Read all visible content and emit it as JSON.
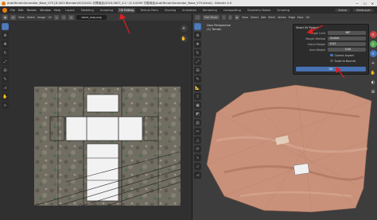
{
  "titlebar": {
    "title": "AutoTerrainGenerator_Base_V75 [D:\\002.Blender\\002\\2401-付費用品\\2024.0627_4.1~\\3.3.0099 付费用品\\AutoTerrainGenerator_Base_V75.blend] - Blender 4.0"
  },
  "menubar": {
    "menus": [
      "File",
      "Edit",
      "Render",
      "Window",
      "Help"
    ],
    "workspaces": [
      "Layout",
      "Modeling",
      "Sculpting",
      "UV Editing",
      "Texture Paint",
      "Shading",
      "Animation",
      "Rendering",
      "Compositing",
      "Geometry Nodes",
      "Scripting"
    ],
    "active_workspace": "UV Editing",
    "scene": "Scene",
    "view_layer": "ViewLayer"
  },
  "uv_editor": {
    "view": "View",
    "select": "Select",
    "image": "Image",
    "uv": "UV",
    "image_name": "stone_map.png"
  },
  "viewport": {
    "mode": "Edit Mode",
    "view": "View",
    "select": "Select",
    "add": "Add",
    "mesh": "Mesh",
    "vertex": "Vertex",
    "edge": "Edge",
    "face": "Face",
    "uv": "UV",
    "perspective": "User Perspective",
    "object": "(1) Terrain"
  },
  "smart_uv_panel": {
    "title": "Smart UV Project",
    "angle_limit_label": "Angle Limit",
    "angle_limit_value": "66°",
    "margin_method_label": "Margin Method",
    "margin_method_value": "Scaled",
    "island_margin_label": "Island Margin",
    "island_margin_value": "0.02",
    "area_weight_label": "Area Weight",
    "area_weight_value": "0.00",
    "correct_aspect_label": "Correct Aspect",
    "correct_aspect_checked": true,
    "scale_to_bounds_label": "Scale to Bounds",
    "scale_to_bounds_checked": false,
    "ok_label": "OK"
  },
  "colors": {
    "accent": "#4772b3",
    "annotation_arrow": "#e02020",
    "terrain": "#c9917a",
    "blender_orange": "#e87d0d"
  }
}
